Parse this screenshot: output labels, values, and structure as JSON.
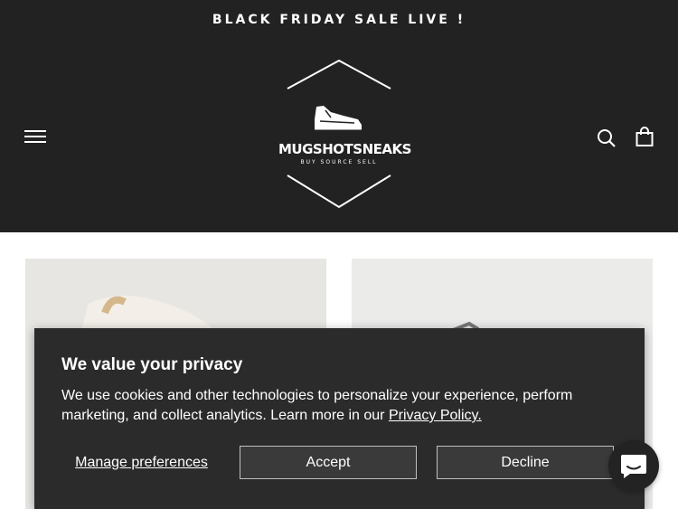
{
  "announcement": {
    "text": "BLACK FRIDAY SALE LIVE !"
  },
  "header": {
    "logo_text": "MUGSHOTSNEAKS",
    "logo_subtext": "BUY SOURCE SELL"
  },
  "icons": {
    "menu": "hamburger-menu-icon",
    "search": "search-icon",
    "cart": "shopping-bag-icon",
    "chat": "chat-icon"
  },
  "cookie_banner": {
    "title": "We value your privacy",
    "body": "We use cookies and other technologies to personalize your experience, perform marketing, and collect analytics. Learn more in our ",
    "link_text": "Privacy Policy.",
    "manage_label": "Manage preferences",
    "accept_label": "Accept",
    "decline_label": "Decline"
  },
  "colors": {
    "header_bg": "#222222",
    "banner_bg": "#2b2b2b",
    "text": "#ffffff"
  }
}
